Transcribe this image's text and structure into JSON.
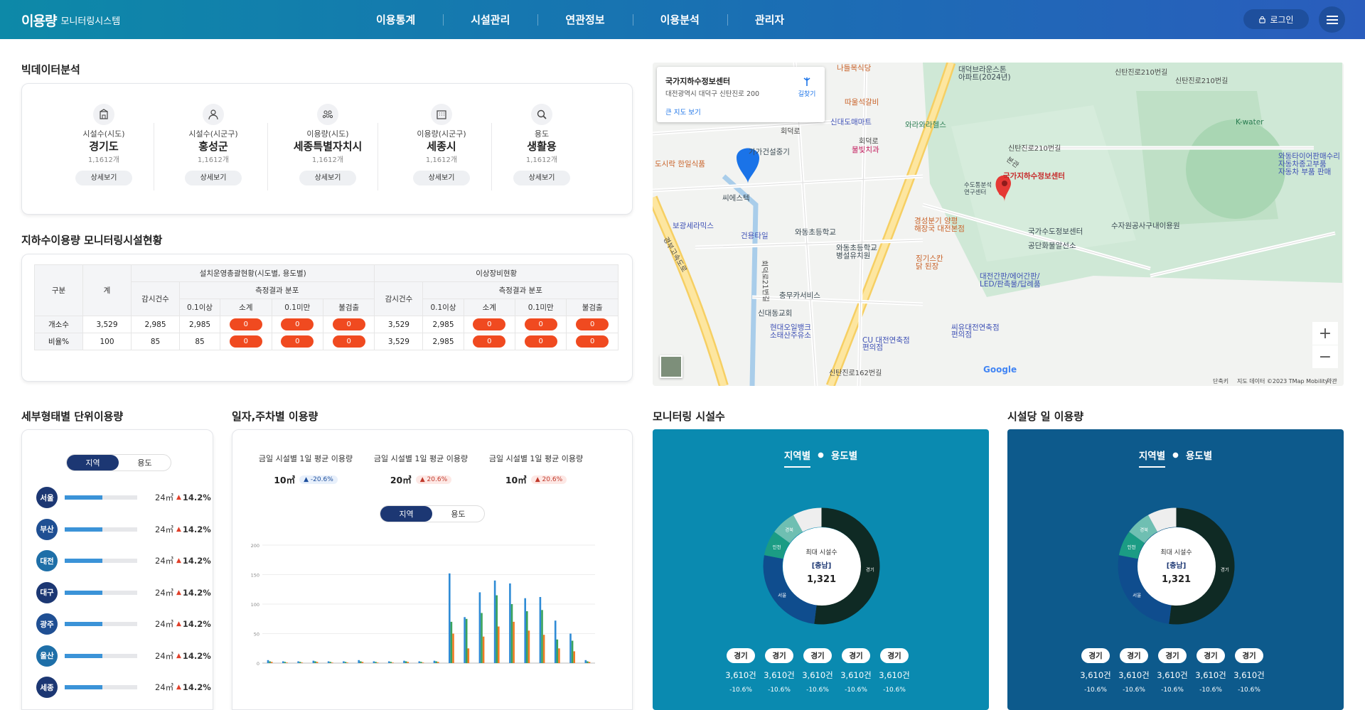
{
  "header": {
    "logo_main": "이용량",
    "logo_sub": "모니터링시스템",
    "nav": [
      "이용통계",
      "시설관리",
      "연관정보",
      "이용분석",
      "관리자"
    ],
    "login_label": "로그인"
  },
  "bigdata": {
    "title": "빅데이터분석",
    "stats": [
      {
        "label": "시설수(시도)",
        "value": "경기도",
        "count": "1,1612개",
        "button": "상세보기",
        "icon": "building-icon"
      },
      {
        "label": "시설수(시군구)",
        "value": "홍성군",
        "count": "1,1612개",
        "button": "상세보기",
        "icon": "person-icon"
      },
      {
        "label": "이용량(시도)",
        "value": "세종특별자치시",
        "count": "1,1612개",
        "button": "상세보기",
        "icon": "group-icon"
      },
      {
        "label": "이용량(시군구)",
        "value": "세종시",
        "count": "1,1612개",
        "button": "상세보기",
        "icon": "office-icon"
      },
      {
        "label": "용도",
        "value": "생활용",
        "count": "1,1612개",
        "button": "상세보기",
        "icon": "search-icon"
      }
    ]
  },
  "facility_table": {
    "title": "지하수이용량 모니터링시설현황",
    "h_category": "구분",
    "h_total": "계",
    "h_group1": "설치운영총괄현황(시도별, 용도별)",
    "h_group2": "이상장비현황",
    "h_inspect": "감시건수",
    "h_dist": "측정결과 분포",
    "h_cols": [
      "0.1이상",
      "소계",
      "0.1미만",
      "불검출"
    ],
    "rows": [
      {
        "label": "개소수",
        "total": "3,529",
        "g1_inspect": "2,985",
        "g1_over": "2,985",
        "g1_pills": [
          "0",
          "0",
          "0"
        ],
        "g2_inspect": "3,529",
        "g2_over": "2,985",
        "g2_pills": [
          "0",
          "0",
          "0"
        ]
      },
      {
        "label": "비율%",
        "total": "100",
        "g1_inspect": "85",
        "g1_over": "85",
        "g1_pills": [
          "0",
          "0",
          "0"
        ],
        "g2_inspect": "3,529",
        "g2_over": "2,985",
        "g2_pills": [
          "0",
          "0",
          "0"
        ]
      }
    ]
  },
  "unit_usage": {
    "title": "세부형태별 단위이용량",
    "toggle": [
      "지역",
      "용도"
    ],
    "regions": [
      {
        "name": "서울",
        "value": "24㎥",
        "pct": "14.2%",
        "fill": 0.52,
        "color": "#1c3773"
      },
      {
        "name": "부산",
        "value": "24㎥",
        "pct": "14.2%",
        "fill": 0.52,
        "color": "#1f4f93"
      },
      {
        "name": "대전",
        "value": "24㎥",
        "pct": "14.2%",
        "fill": 0.52,
        "color": "#1e6fa8"
      },
      {
        "name": "대구",
        "value": "24㎥",
        "pct": "14.2%",
        "fill": 0.52,
        "color": "#1c3773"
      },
      {
        "name": "광주",
        "value": "24㎥",
        "pct": "14.2%",
        "fill": 0.52,
        "color": "#1f4f93"
      },
      {
        "name": "울산",
        "value": "24㎥",
        "pct": "14.2%",
        "fill": 0.52,
        "color": "#1e6fa8"
      },
      {
        "name": "세종",
        "value": "24㎥",
        "pct": "14.2%",
        "fill": 0.52,
        "color": "#1c3773"
      }
    ]
  },
  "daily_usage": {
    "title": "일자,주차별 이용량",
    "kpis": [
      {
        "title": "금일 시설별 1일 평균 이용량",
        "value": "10㎥",
        "change": "-20.6%",
        "dir": "down"
      },
      {
        "title": "금일 시설별 1일 평균 이용량",
        "value": "20㎥",
        "change": "20.6%",
        "dir": "up"
      },
      {
        "title": "금일 시설별 1일 평균 이용량",
        "value": "10㎥",
        "change": "20.6%",
        "dir": "up"
      }
    ],
    "toggle": [
      "지역",
      "용도"
    ]
  },
  "chart_data": {
    "type": "bar",
    "title": "",
    "xlabel": "",
    "ylabel": "",
    "ylim": [
      0,
      200
    ],
    "yticks": [
      0,
      50,
      100,
      150,
      200
    ],
    "categories": [
      "",
      "",
      "",
      "",
      "",
      "",
      "",
      "",
      "",
      "",
      "",
      "",
      "",
      "",
      "",
      "",
      "",
      "",
      "",
      "",
      "",
      ""
    ],
    "series": [
      {
        "color": "#2f8bd6",
        "values": [
          5,
          3,
          3,
          4,
          3,
          3,
          5,
          3,
          3,
          4,
          3,
          4,
          152,
          78,
          120,
          140,
          135,
          110,
          112,
          72,
          50,
          5
        ]
      },
      {
        "color": "#3aa35c",
        "values": [
          3,
          2,
          2,
          3,
          2,
          2,
          3,
          2,
          2,
          3,
          2,
          3,
          70,
          75,
          85,
          115,
          100,
          88,
          90,
          40,
          38,
          3
        ]
      },
      {
        "color": "#f07a23",
        "values": [
          2,
          1,
          1,
          2,
          1,
          1,
          2,
          1,
          1,
          2,
          1,
          2,
          50,
          25,
          45,
          62,
          70,
          55,
          48,
          25,
          20,
          2
        ]
      }
    ]
  },
  "monitoring": {
    "title": "모니터링 시설수",
    "color": "#0a8ab0",
    "tabs": [
      "지역별",
      "용도별"
    ],
    "center_label": "최대 시설수",
    "center_region": "[충남]",
    "center_value": "1,321",
    "segments": [
      {
        "label": "경기",
        "value": 52,
        "color": "#0f2a24"
      },
      {
        "label": "서울",
        "value": 26,
        "color": "#0f4d8e"
      },
      {
        "label": "인천",
        "value": 7,
        "color": "#1b9c84"
      },
      {
        "label": "경북",
        "value": 7,
        "color": "#6fbfb2"
      },
      {
        "label": "",
        "value": 8,
        "color": "#eeeeee"
      }
    ],
    "stats": [
      {
        "chip": "경기",
        "value": "3,610건",
        "pct": "-10.6%"
      },
      {
        "chip": "경기",
        "value": "3,610건",
        "pct": "-10.6%"
      },
      {
        "chip": "경기",
        "value": "3,610건",
        "pct": "-10.6%"
      },
      {
        "chip": "경기",
        "value": "3,610건",
        "pct": "-10.6%"
      },
      {
        "chip": "경기",
        "value": "3,610건",
        "pct": "-10.6%"
      }
    ]
  },
  "per_facility": {
    "title": "시설당 일 이용량",
    "color": "#0d5a8c",
    "tabs": [
      "지역별",
      "용도별"
    ],
    "center_label": "최대 시설수",
    "center_region": "[충남]",
    "center_value": "1,321",
    "segments": [
      {
        "label": "경기",
        "value": 52,
        "color": "#0f2a24"
      },
      {
        "label": "서울",
        "value": 26,
        "color": "#0f4d8e"
      },
      {
        "label": "인천",
        "value": 7,
        "color": "#1b9c84"
      },
      {
        "label": "경북",
        "value": 7,
        "color": "#6fbfb2"
      },
      {
        "label": "",
        "value": 8,
        "color": "#eeeeee"
      }
    ],
    "stats": [
      {
        "chip": "경기",
        "value": "3,610건",
        "pct": "-10.6%"
      },
      {
        "chip": "경기",
        "value": "3,610건",
        "pct": "-10.6%"
      },
      {
        "chip": "경기",
        "value": "3,610건",
        "pct": "-10.6%"
      },
      {
        "chip": "경기",
        "value": "3,610건",
        "pct": "-10.6%"
      },
      {
        "chip": "경기",
        "value": "3,610건",
        "pct": "-10.6%"
      }
    ]
  },
  "map": {
    "info_title": "국가지하수정보센터",
    "info_address": "대전광역시 대덕구 신탄진로 200",
    "info_link": "큰 지도 보기",
    "info_direction": "길찾기",
    "marker_label": "국가지하수정보센터",
    "labels": [
      {
        "t": "나들목식당",
        "c": "ml-or"
      },
      {
        "t": "대덕브라운스톤\n아파트(2024년)",
        "c": "ml-gr"
      },
      {
        "t": "신탄진로210번길",
        "c": "ml-road"
      },
      {
        "t": "신탄진로210번길",
        "c": "ml-road"
      },
      {
        "t": "신탄진로210번길",
        "c": "ml-road"
      },
      {
        "t": "따울석갈비",
        "c": "ml-or"
      },
      {
        "t": "신대도매마트",
        "c": "ml-bl"
      },
      {
        "t": "와라와라헬스",
        "c": "ml-gn"
      },
      {
        "t": "물빛치과",
        "c": "ml-pk"
      },
      {
        "t": "가가건설중기",
        "c": "ml-gr"
      },
      {
        "t": "도시락 한일식품",
        "c": "ml-or"
      },
      {
        "t": "K-water",
        "c": "ml-gn"
      },
      {
        "t": "와동타이어판매수리\n자동차종고부품\n자동차 부품 판매",
        "c": "ml-bl"
      },
      {
        "t": "씨에스텍",
        "c": "ml-gr"
      },
      {
        "t": "수도통분석\n연구센터",
        "c": "ml-gr"
      },
      {
        "t": "경성분기 양평\n해장국 대전본점",
        "c": "ml-or"
      },
      {
        "t": "국가수도정보센터",
        "c": "ml-gr"
      },
      {
        "t": "공단화물알선소",
        "c": "ml-gr"
      },
      {
        "t": "수자원공사구내이용원",
        "c": "ml-gr"
      },
      {
        "t": "보광세라믹스",
        "c": "ml-bl"
      },
      {
        "t": "건용타일",
        "c": "ml-bl"
      },
      {
        "t": "와동초등학교",
        "c": "ml-gr"
      },
      {
        "t": "와동초등학교\n병설유치원",
        "c": "ml-gr"
      },
      {
        "t": "징기스칸\n닭 된장",
        "c": "ml-or"
      },
      {
        "t": "대전간판/에어간판/\nLED/판촉물/답례품",
        "c": "ml-bl"
      },
      {
        "t": "충무카서비스",
        "c": "ml-gr"
      },
      {
        "t": "신대동교회",
        "c": "ml-gr"
      },
      {
        "t": "현대오일뱅크\n소태산주유소",
        "c": "ml-bl"
      },
      {
        "t": "CU 대전연축점\n편의점",
        "c": "ml-bl"
      },
      {
        "t": "씨유대전연축점\n편의점",
        "c": "ml-bl"
      },
      {
        "t": "신탄진로162번길",
        "c": "ml-road"
      },
      {
        "t": "회덕로",
        "c": "ml-road"
      },
      {
        "t": "회덕로",
        "c": "ml-road"
      },
      {
        "t": "경부고속도로",
        "c": "ml-road"
      },
      {
        "t": "회덕로21번길",
        "c": "ml-road"
      },
      {
        "t": "본관",
        "c": "ml-road"
      }
    ],
    "google": "Google",
    "attr1": "단축키",
    "attr2": "지도 데이터 ©2023 TMap Mobility",
    "attr3": "약관",
    "zoom_in": "+",
    "zoom_out": "−"
  }
}
